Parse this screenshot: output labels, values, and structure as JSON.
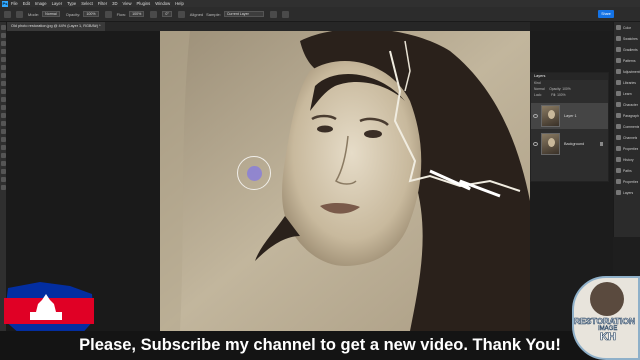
{
  "app": {
    "logo": "Ps",
    "menu": [
      "File",
      "Edit",
      "Image",
      "Layer",
      "Type",
      "Select",
      "Filter",
      "3D",
      "View",
      "Plugins",
      "Window",
      "Help"
    ]
  },
  "options": {
    "mode_label": "Mode:",
    "mode_value": "Normal",
    "opacity_label": "Opacity:",
    "opacity_value": "100%",
    "flow_label": "Flow:",
    "flow_value": "100%",
    "angle_value": "0°",
    "aligned_label": "Aligned",
    "sample_label": "Sample:",
    "sample_value": "Current Layer",
    "share_label": "Share"
  },
  "document": {
    "tab_title": "Old photo restoration.jpg @ 44% (Layer 1, RGB/8#) *"
  },
  "layers_panel": {
    "title": "Layers",
    "filter_label": "Kind",
    "blend_mode": "Normal",
    "opacity_label": "Opacity:",
    "opacity_value": "100%",
    "lock_label": "Lock:",
    "fill_label": "Fill:",
    "fill_value": "100%",
    "layers": [
      {
        "name": "Layer 1",
        "selected": true,
        "locked": false
      },
      {
        "name": "Background",
        "selected": false,
        "locked": true
      }
    ]
  },
  "right_panels": [
    "Color",
    "Swatches",
    "Gradients",
    "Patterns",
    "Adjustments",
    "Libraries",
    "Learn",
    "Character",
    "Paragraph",
    "Comments",
    "Channels",
    "Properties",
    "History",
    "Paths",
    "Properties",
    "Layers"
  ],
  "overlay": {
    "subtitle": "Please, Subscribe my channel to get a new video. Thank You!",
    "logo_line1": "RESTORATION",
    "logo_line2": "IMAGE",
    "logo_line3": "KH"
  },
  "colors": {
    "accent": "#1473e6",
    "brush_cursor": "#8a7fd8",
    "flag_blue": "#032ea1",
    "flag_red": "#e00025"
  }
}
